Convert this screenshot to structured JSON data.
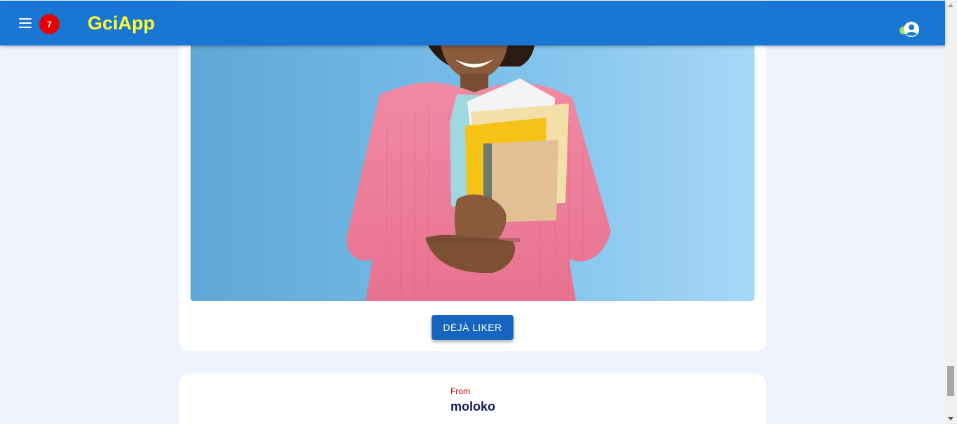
{
  "appbar": {
    "title": "GciApp",
    "notification_count": "7",
    "colors": {
      "bar": "#1976d2",
      "title": "#ffff33",
      "badge": "#e60000",
      "status_dot": "#9be35a"
    }
  },
  "post": {
    "image_description_icon": "photo-woman-pink-sweater-holding-folders",
    "like_button_label": "DÉJÀ LIKER"
  },
  "next_post": {
    "from_label": "From",
    "author": "moloko"
  },
  "icons": {
    "menu": "hamburger-menu-icon",
    "account": "account-circle-icon"
  }
}
